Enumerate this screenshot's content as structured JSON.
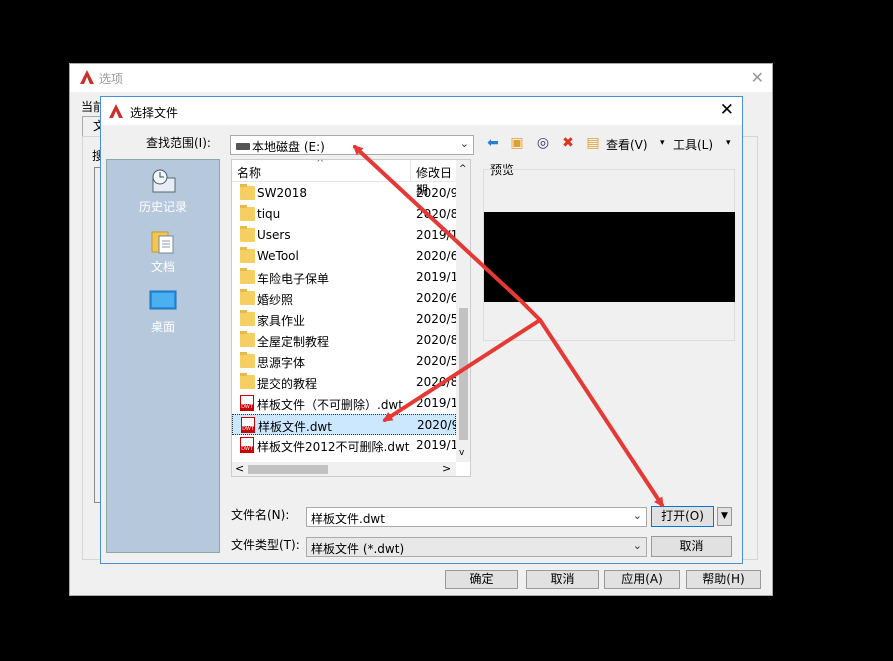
{
  "background_window": {
    "title": "选项",
    "current_label": "当前",
    "tab_fragment": "文",
    "tab_fragment2": "搜",
    "buttons": {
      "ok": "确定",
      "cancel": "取消",
      "apply": "应用(A)",
      "help": "帮助(H)"
    }
  },
  "dialog": {
    "title": "选择文件",
    "look_in_label": "查找范围(I):",
    "look_in_value": "本地磁盘 (E:)",
    "toolbar": {
      "views_label": "查看(V)",
      "tools_label": "工具(L)"
    },
    "places": [
      {
        "label": "历史记录",
        "icon": "history-icon"
      },
      {
        "label": "文档",
        "icon": "documents-icon"
      },
      {
        "label": "桌面",
        "icon": "desktop-icon"
      }
    ],
    "columns": {
      "name": "名称",
      "date": "修改日期"
    },
    "files": [
      {
        "name": "SW2018",
        "date": "2020/9",
        "type": "folder"
      },
      {
        "name": "tiqu",
        "date": "2020/8",
        "type": "folder"
      },
      {
        "name": "Users",
        "date": "2019/1",
        "type": "folder"
      },
      {
        "name": "WeTool",
        "date": "2020/6",
        "type": "folder"
      },
      {
        "name": "车险电子保单",
        "date": "2019/1",
        "type": "folder"
      },
      {
        "name": "婚纱照",
        "date": "2020/6",
        "type": "folder"
      },
      {
        "name": "家具作业",
        "date": "2020/5",
        "type": "folder"
      },
      {
        "name": "全屋定制教程",
        "date": "2020/8",
        "type": "folder"
      },
      {
        "name": "思源字体",
        "date": "2020/5",
        "type": "folder"
      },
      {
        "name": "提交的教程",
        "date": "2020/8",
        "type": "folder"
      },
      {
        "name": "样板文件（不可删除）.dwt",
        "date": "2019/1",
        "type": "dwt"
      },
      {
        "name": "样板文件.dwt",
        "date": "2020/9",
        "type": "dwt",
        "selected": true
      },
      {
        "name": "样板文件2012不可删除.dwt",
        "date": "2019/1",
        "type": "dwt"
      }
    ],
    "preview_label": "预览",
    "file_name_label": "文件名(N):",
    "file_name_value": "样板文件.dwt",
    "file_type_label": "文件类型(T):",
    "file_type_value": "样板文件 (*.dwt)",
    "open_button": "打开(O)",
    "cancel_button": "取消"
  },
  "annotation_color": "#e53935"
}
